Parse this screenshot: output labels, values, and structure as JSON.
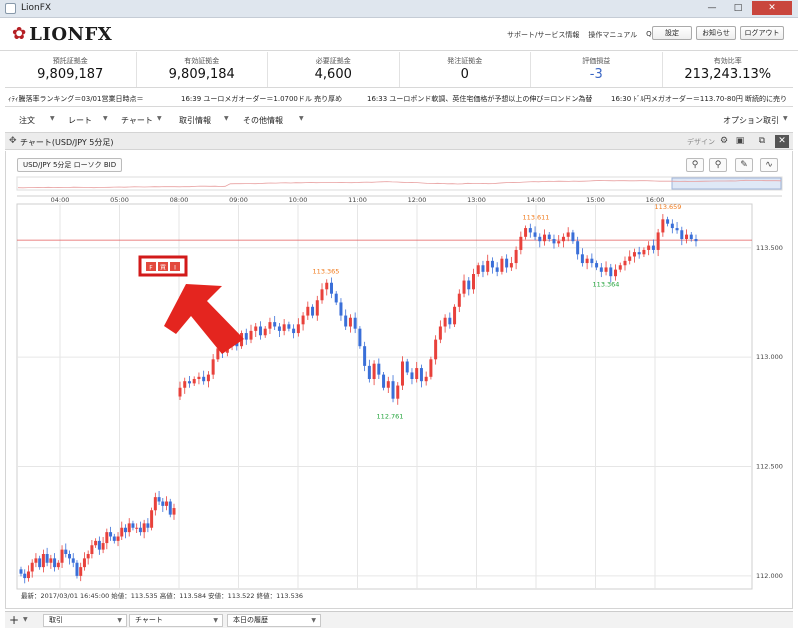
{
  "window": {
    "title": "LionFX"
  },
  "header": {
    "logo_text": "LIONFX",
    "links": [
      "サポート/サービス情報",
      "操作マニュアル",
      "Q&A"
    ],
    "buttons": [
      "設定",
      "お知らせ",
      "ログアウト"
    ]
  },
  "summary": [
    {
      "label": "預託証拠金",
      "value": "9,809,187"
    },
    {
      "label": "有効証拠金",
      "value": "9,809,184"
    },
    {
      "label": "必要証拠金",
      "value": "4,600"
    },
    {
      "label": "発注証拠金",
      "value": "0"
    },
    {
      "label": "評価損益",
      "value": "-3"
    },
    {
      "label": "有効比率",
      "value": "213,243.13%"
    }
  ],
  "ticker": [
    "ｨﾃｨ騰落率ランキング＝03/01営業日時点＝",
    "16:39  ユーロメガオーダー＝1.0700ドル  売り厚め",
    "16:33  ユーロポンド軟調、英住宅価格が予想以上の伸び＝ロンドン為替",
    "16:30  ﾄﾞﾙ円メガオーダー＝113.70-80円  断続的に売り"
  ],
  "menu": {
    "items": [
      "注文",
      "レート",
      "チャート",
      "取引情報",
      "その他情報"
    ],
    "option": "オプション取引"
  },
  "chart_window": {
    "title": "チャート(USD/JPY 5分足)",
    "design_label": "デザイン",
    "symbol_label": "USD/JPY 5分足 ローソク BID"
  },
  "marker": {
    "letters": [
      "F",
      "買",
      "I"
    ]
  },
  "status": "最新：2017/03/01 16:45:00  始値：113.535  高値：113.584  安値：113.522  終値：113.536",
  "bottom_tabs": [
    "取引",
    "チャート",
    "本日の履歴"
  ],
  "colors": {
    "up": "#e8413b",
    "down": "#3a6fd8",
    "accent": "#b51f24",
    "high_label": "#f07a1c",
    "low_label": "#22a33a"
  },
  "icons": [
    "minimize-icon",
    "maximize-icon",
    "close-icon",
    "move-icon",
    "gear-icon",
    "zoom-in-icon",
    "zoom-out-icon",
    "pencil-icon",
    "indicator-icon"
  ],
  "chart_data": {
    "type": "candlestick",
    "x_ticks": [
      "04:00",
      "05:00",
      "08:00",
      "09:00",
      "10:00",
      "11:00",
      "12:00",
      "13:00",
      "14:00",
      "15:00",
      "16:00"
    ],
    "y_ticks": [
      "113.500",
      "113.000",
      "112.500",
      "112.000"
    ],
    "ylim": [
      111.94,
      113.7
    ],
    "position_line": 113.535,
    "high_low_labels": [
      {
        "text": "113.365",
        "kind": "high",
        "value": 113.365
      },
      {
        "text": "112.761",
        "kind": "low",
        "value": 112.761
      },
      {
        "text": "113.611",
        "kind": "high",
        "value": 113.611
      },
      {
        "text": "113.364",
        "kind": "low",
        "value": 113.364
      },
      {
        "text": "113.659",
        "kind": "high",
        "value": 113.659
      }
    ],
    "closes": [
      112.01,
      111.99,
      112.02,
      112.06,
      112.08,
      112.04,
      112.1,
      112.06,
      112.08,
      112.04,
      112.06,
      112.12,
      112.1,
      112.08,
      112.06,
      112.0,
      112.04,
      112.08,
      112.1,
      112.14,
      112.16,
      112.12,
      112.15,
      112.2,
      112.18,
      112.16,
      112.18,
      112.22,
      112.2,
      112.24,
      112.22,
      112.22,
      112.2,
      112.24,
      112.22,
      112.3,
      112.36,
      112.34,
      112.32,
      112.34,
      112.28,
      112.31,
      112.86,
      112.89,
      112.88,
      112.9,
      112.91,
      112.89,
      112.92,
      112.99,
      113.04,
      113.02,
      113.06,
      113.09,
      113.05,
      113.11,
      113.08,
      113.12,
      113.14,
      113.1,
      113.13,
      113.16,
      113.14,
      113.12,
      113.15,
      113.13,
      113.11,
      113.15,
      113.19,
      113.23,
      113.19,
      113.26,
      113.31,
      113.34,
      113.29,
      113.25,
      113.19,
      113.14,
      113.18,
      113.13,
      113.05,
      112.96,
      112.9,
      112.97,
      112.92,
      112.86,
      112.89,
      112.81,
      112.87,
      112.98,
      112.93,
      112.9,
      112.95,
      112.89,
      112.91,
      112.99,
      113.08,
      113.14,
      113.18,
      113.15,
      113.23,
      113.29,
      113.35,
      113.31,
      113.38,
      113.42,
      113.39,
      113.44,
      113.41,
      113.39,
      113.45,
      113.41,
      113.43,
      113.49,
      113.55,
      113.59,
      113.57,
      113.55,
      113.53,
      113.56,
      113.54,
      113.52,
      113.53,
      113.55,
      113.57,
      113.53,
      113.47,
      113.43,
      113.45,
      113.43,
      113.41,
      113.39,
      113.41,
      113.37,
      113.4,
      113.42,
      113.44,
      113.46,
      113.48,
      113.47,
      113.49,
      113.51,
      113.49,
      113.57,
      113.63,
      113.61,
      113.59,
      113.58,
      113.54,
      113.56,
      113.54,
      113.53
    ],
    "open": 112.03
  }
}
